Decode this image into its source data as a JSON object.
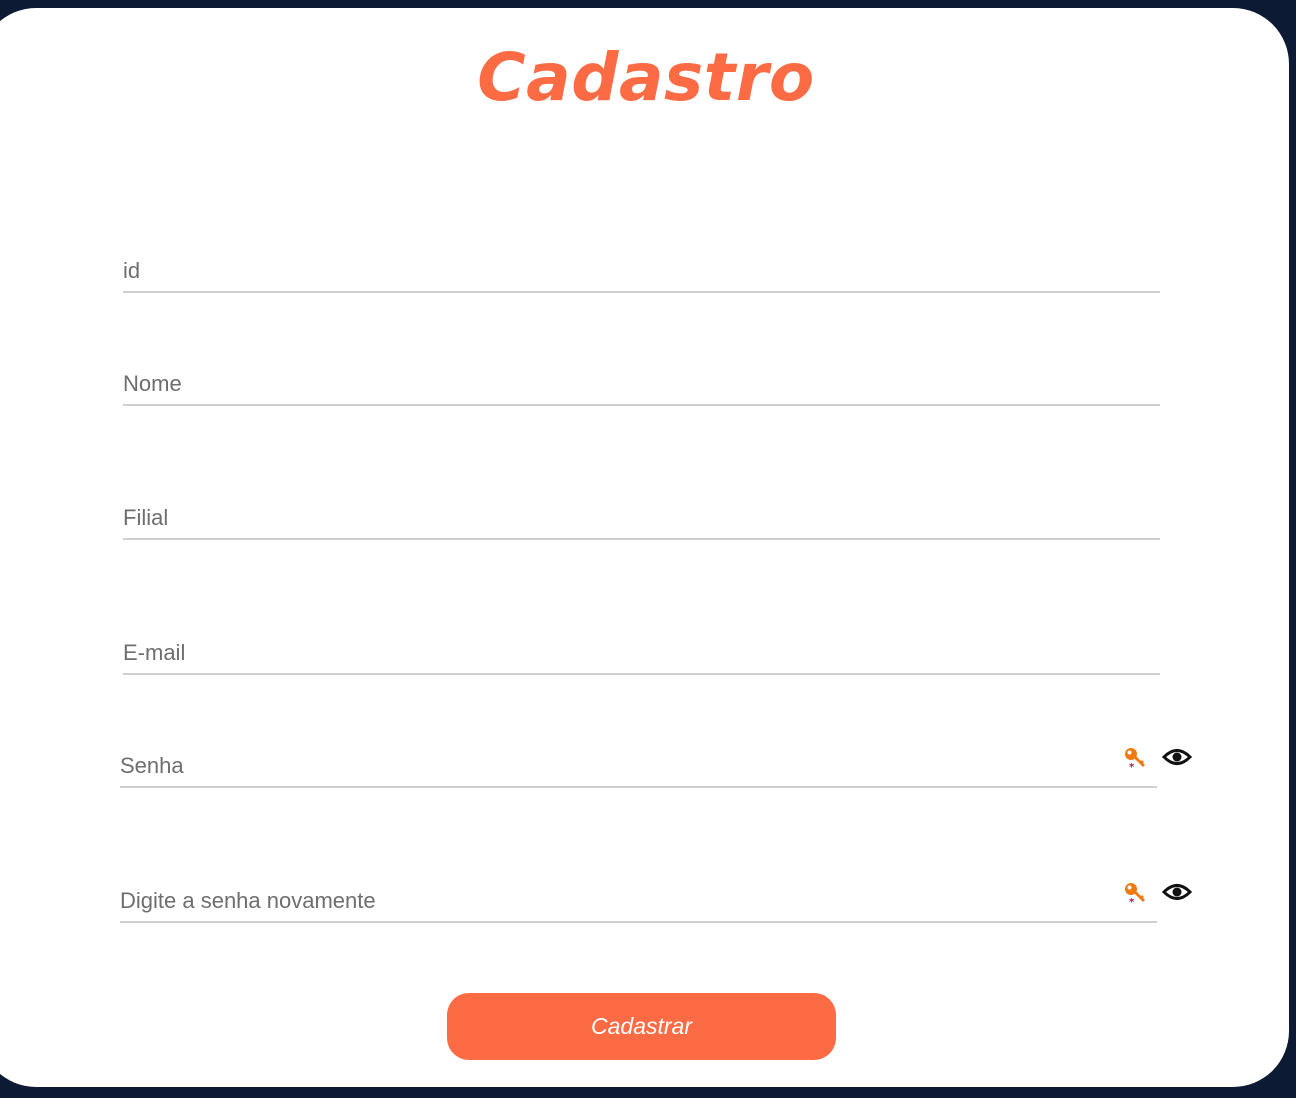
{
  "page": {
    "title": "Cadastro",
    "accent_color": "#fd6b45",
    "background_color": "#0c1a33"
  },
  "form": {
    "fields": [
      {
        "name": "id",
        "placeholder": "id",
        "value": ""
      },
      {
        "name": "nome",
        "placeholder": "Nome",
        "value": ""
      },
      {
        "name": "filial",
        "placeholder": "Filial",
        "value": ""
      },
      {
        "name": "email",
        "placeholder": "E-mail",
        "value": ""
      },
      {
        "name": "senha",
        "placeholder": "Senha",
        "value": "",
        "icons": [
          "key-icon",
          "eye-icon"
        ]
      },
      {
        "name": "senha-confirmacao",
        "placeholder": "Digite a senha novamente",
        "value": "",
        "icons": [
          "key-icon",
          "eye-icon"
        ]
      }
    ],
    "submit_label": "Cadastrar"
  }
}
